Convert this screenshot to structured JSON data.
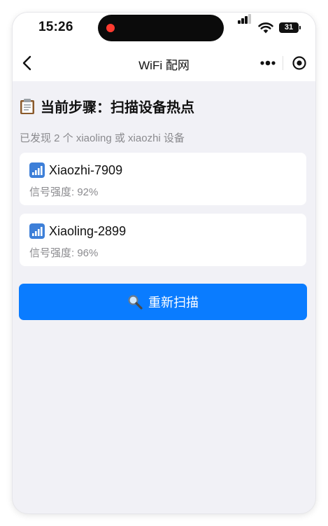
{
  "status_bar": {
    "time": "15:26",
    "battery": "31"
  },
  "nav": {
    "title": "WiFi 配网",
    "back_icon": "chevron-left-icon",
    "more_icon": "more-dots-icon",
    "record_icon": "record-icon"
  },
  "step": {
    "icon": "clipboard-icon",
    "label": "当前步骤：扫描设备热点"
  },
  "found_text": "已发现 2 个 xiaoling 或 xiaozhi 设备",
  "devices": [
    {
      "icon": "antenna-bars-icon",
      "name": "Xiaozhi-7909",
      "signal": "信号强度: 92%"
    },
    {
      "icon": "antenna-bars-icon",
      "name": "Xiaoling-2899",
      "signal": "信号强度: 96%"
    }
  ],
  "rescan_button": {
    "icon": "magnifier-icon",
    "label": "重新扫描"
  },
  "colors": {
    "primary": "#0a7cff",
    "page_bg": "#f1f1f6",
    "card_bg": "#ffffff",
    "muted_text": "#8a8a8e",
    "recording_dot": "#ff3b30"
  }
}
